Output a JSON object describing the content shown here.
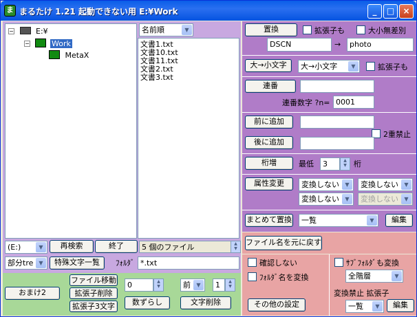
{
  "window": {
    "title": "まるたけ 1.21 起動できない用 E:¥Work",
    "min": "_",
    "max": "□",
    "close": "×"
  },
  "tree": {
    "root": "E:¥",
    "work": "Work",
    "meta": "MetaX",
    "expand": "−"
  },
  "filelist": {
    "sort_value": "名前順",
    "files": [
      "文書1.txt",
      "文書10.txt",
      "文書11.txt",
      "文書2.txt",
      "文書3.txt"
    ]
  },
  "bottom_left": {
    "drive_value": "(E:)",
    "research": "再検索",
    "quit": "終了",
    "file_count": "5 個のファイル",
    "partial_value": "部分tre",
    "special_chars": "特殊文字一覧",
    "folder_label": "ﾌｫﾙﾀﾞ",
    "filter_value": "*.txt",
    "omake": "おまけ2",
    "file_move": "ファイル移動",
    "ext_delete": "拡張子削除",
    "ext_3char": "拡張子3文字",
    "offset_value": "0",
    "shift_num": "数ずらし",
    "pos_value": "前",
    "del_count_value": "1",
    "char_delete": "文字削除"
  },
  "replace": {
    "button": "置換",
    "ext_check": "拡張子も",
    "case_check": "大小無差別",
    "from_value": "DSCN",
    "arrow": "→",
    "to_value": "photo"
  },
  "case": {
    "button": "大→小文字",
    "mode_value": "大→小文字",
    "ext_check": "拡張子も"
  },
  "serial": {
    "button": "連番",
    "input_value": "",
    "digits_label": "連番数字 ?n=",
    "digits_value": "0001"
  },
  "affix": {
    "prefix_button": "前に追加",
    "suffix_button": "後に追加",
    "prefix_value": "",
    "suffix_value": "",
    "no_double": "2重禁止"
  },
  "digits": {
    "button": "桁増",
    "min_label": "最低",
    "value": "3",
    "unit": "桁"
  },
  "attr": {
    "button": "属性変更",
    "s1": "変換しない",
    "s2": "変換しない",
    "s3": "変換しない",
    "s4": "変換しない"
  },
  "batch": {
    "button": "まとめて置換",
    "list_value": "一覧",
    "edit": "編集"
  },
  "restore": {
    "button": "ファイル名を元に戻す"
  },
  "options": {
    "no_confirm": "確認しない",
    "subfolder": "ｻﾌﾞﾌｫﾙﾀﾞも変換",
    "depth_value": "全階層",
    "folder_name": "ﾌｫﾙﾀﾞ名を変換",
    "no_convert_ext": "変換禁止 拡張子",
    "other_settings": "その他の設定",
    "ext_list_value": "一覧",
    "ext_edit": "編集"
  },
  "colors": {
    "left_bg": "#c8a8e0",
    "right_bg": "#b07cc8",
    "option_bg": "#e8a4a4",
    "bottom_bg": "#a8d898",
    "title": "#0a5ee8"
  }
}
